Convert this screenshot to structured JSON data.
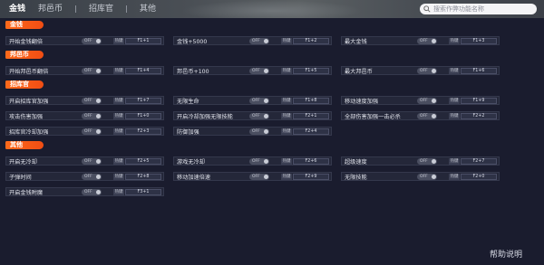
{
  "nav": {
    "tabs": [
      "金钱",
      "邦邑币",
      "招库官",
      "其他"
    ]
  },
  "search": {
    "placeholder": "搜索作弊功能名称"
  },
  "sections": {
    "s1": "金钱",
    "s2": "邦邑币",
    "s3": "招库官",
    "s4": "其他"
  },
  "toggle_text": "OFF",
  "key_prefix": "热键",
  "rows": {
    "r1": [
      {
        "label": "开始金钱翻倍",
        "hotkey": "F1+1"
      },
      {
        "label": "金钱+5000",
        "hotkey": "F1+2"
      },
      {
        "label": "最大金钱",
        "hotkey": "F1+3"
      }
    ],
    "r2": [
      {
        "label": "开始邦邑币翻倍",
        "hotkey": "F1+4"
      },
      {
        "label": "邦邑币+100",
        "hotkey": "F1+5"
      },
      {
        "label": "最大邦邑币",
        "hotkey": "F1+6"
      }
    ],
    "r3": [
      {
        "label": "开启招库官加强",
        "hotkey": "F1+7"
      },
      {
        "label": "无限生命",
        "hotkey": "F1+8"
      },
      {
        "label": "移动速度加强",
        "hotkey": "F1+9"
      }
    ],
    "r4": [
      {
        "label": "攻击伤害加强",
        "hotkey": "F1+0"
      },
      {
        "label": "开启冷却加强无限技能",
        "hotkey": "F2+1"
      },
      {
        "label": "全部伤害加强一击必杀",
        "hotkey": "F2+2"
      }
    ],
    "r5": [
      {
        "label": "招库官冷却加强",
        "hotkey": "F2+3"
      },
      {
        "label": "防御加强",
        "hotkey": "F2+4"
      }
    ],
    "r6": [
      {
        "label": "开启无冷却",
        "hotkey": "F2+5"
      },
      {
        "label": "游戏无冷却",
        "hotkey": "F2+6"
      },
      {
        "label": "超级速度",
        "hotkey": "F2+7"
      }
    ],
    "r7": [
      {
        "label": "子弹时间",
        "hotkey": "F2+8"
      },
      {
        "label": "移动加速倍速",
        "hotkey": "F2+9"
      },
      {
        "label": "无限技能",
        "hotkey": "F2+0"
      }
    ],
    "r8": [
      {
        "label": "开启金钱附魔",
        "hotkey": "F3+1"
      }
    ]
  },
  "help": "帮助说明",
  "colors": {
    "accent": "#f05a16",
    "background": "#1a1c2e"
  },
  "icons": {
    "search": "search-icon"
  }
}
